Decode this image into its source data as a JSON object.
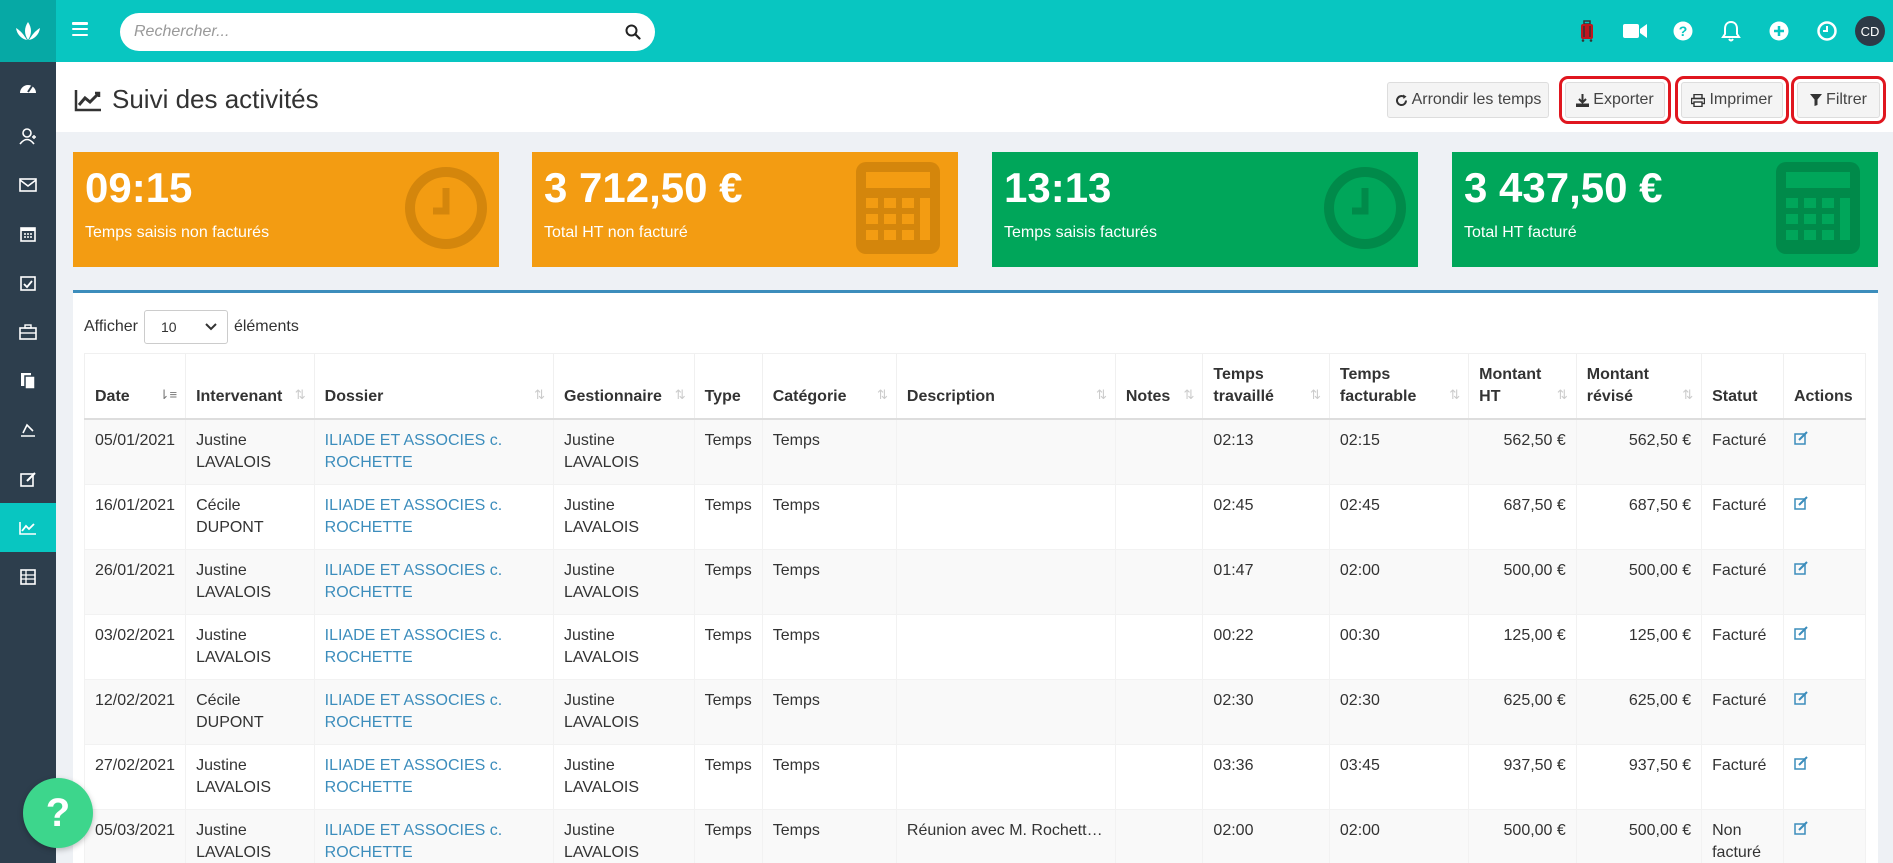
{
  "search": {
    "placeholder": "Rechercher..."
  },
  "user": {
    "initials": "CD"
  },
  "page": {
    "title": "Suivi des activités"
  },
  "buttons": {
    "round": "Arrondir les temps",
    "export": "Exporter",
    "print": "Imprimer",
    "filter": "Filtrer"
  },
  "cards": [
    {
      "value": "09:15",
      "label": "Temps saisis non facturés",
      "icon": "clock-icon"
    },
    {
      "value": "3 712,50 €",
      "label": "Total HT non facturé",
      "icon": "calculator-icon"
    },
    {
      "value": "13:13",
      "label": "Temps saisis facturés",
      "icon": "clock-icon"
    },
    {
      "value": "3 437,50 €",
      "label": "Total HT facturé",
      "icon": "calculator-icon"
    }
  ],
  "table_length": {
    "prefix": "Afficher",
    "value": "10",
    "suffix": "éléments"
  },
  "columns": [
    "Date",
    "Intervenant",
    "Dossier",
    "Gestionnaire",
    "Type",
    "Catégorie",
    "Description",
    "Notes",
    "Temps travaillé",
    "Temps facturable",
    "Montant HT",
    "Montant révisé",
    "Statut",
    "Actions"
  ],
  "rows": [
    {
      "date": "05/01/2021",
      "intervenant": "Justine LAVALOIS",
      "dossier": "ILIADE ET ASSOCIES c. ROCHETTE",
      "gestionnaire": "Justine LAVALOIS",
      "type": "Temps",
      "categorie": "Temps",
      "description": "",
      "notes": "",
      "travaille": "02:13",
      "facturable": "02:15",
      "montant": "562,50 €",
      "revise": "562,50 €",
      "statut": "Facturé"
    },
    {
      "date": "16/01/2021",
      "intervenant": "Cécile DUPONT",
      "dossier": "ILIADE ET ASSOCIES c. ROCHETTE",
      "gestionnaire": "Justine LAVALOIS",
      "type": "Temps",
      "categorie": "Temps",
      "description": "",
      "notes": "",
      "travaille": "02:45",
      "facturable": "02:45",
      "montant": "687,50 €",
      "revise": "687,50 €",
      "statut": "Facturé"
    },
    {
      "date": "26/01/2021",
      "intervenant": "Justine LAVALOIS",
      "dossier": "ILIADE ET ASSOCIES c. ROCHETTE",
      "gestionnaire": "Justine LAVALOIS",
      "type": "Temps",
      "categorie": "Temps",
      "description": "",
      "notes": "",
      "travaille": "01:47",
      "facturable": "02:00",
      "montant": "500,00 €",
      "revise": "500,00 €",
      "statut": "Facturé"
    },
    {
      "date": "03/02/2021",
      "intervenant": "Justine LAVALOIS",
      "dossier": "ILIADE ET ASSOCIES c. ROCHETTE",
      "gestionnaire": "Justine LAVALOIS",
      "type": "Temps",
      "categorie": "Temps",
      "description": "",
      "notes": "",
      "travaille": "00:22",
      "facturable": "00:30",
      "montant": "125,00 €",
      "revise": "125,00 €",
      "statut": "Facturé"
    },
    {
      "date": "12/02/2021",
      "intervenant": "Cécile DUPONT",
      "dossier": "ILIADE ET ASSOCIES c. ROCHETTE",
      "gestionnaire": "Justine LAVALOIS",
      "type": "Temps",
      "categorie": "Temps",
      "description": "",
      "notes": "",
      "travaille": "02:30",
      "facturable": "02:30",
      "montant": "625,00 €",
      "revise": "625,00 €",
      "statut": "Facturé"
    },
    {
      "date": "27/02/2021",
      "intervenant": "Justine LAVALOIS",
      "dossier": "ILIADE ET ASSOCIES c. ROCHETTE",
      "gestionnaire": "Justine LAVALOIS",
      "type": "Temps",
      "categorie": "Temps",
      "description": "",
      "notes": "",
      "travaille": "03:36",
      "facturable": "03:45",
      "montant": "937,50 €",
      "revise": "937,50 €",
      "statut": "Facturé"
    },
    {
      "date": "05/03/2021",
      "intervenant": "Justine LAVALOIS",
      "dossier": "ILIADE ET ASSOCIES c. ROCHETTE",
      "gestionnaire": "Justine LAVALOIS",
      "type": "Temps",
      "categorie": "Temps",
      "description": "Réunion avec M. Rochett…",
      "notes": "",
      "travaille": "02:00",
      "facturable": "02:00",
      "montant": "500,00 €",
      "revise": "500,00 €",
      "statut": "Non facturé"
    }
  ],
  "sidebar": [
    "dashboard-icon",
    "contacts-icon",
    "mail-icon",
    "calendar-icon",
    "tasks-icon",
    "briefcase-icon",
    "documents-icon",
    "invoice-icon",
    "edit-icon",
    "chart-icon",
    "table-icon"
  ],
  "colors": {
    "topbar": "#08c6c1",
    "sidebar": "#2d3e4d",
    "orange": "#f39c12",
    "green": "#00a65a",
    "link": "#3c8dbc",
    "highlight": "#e0161f"
  }
}
